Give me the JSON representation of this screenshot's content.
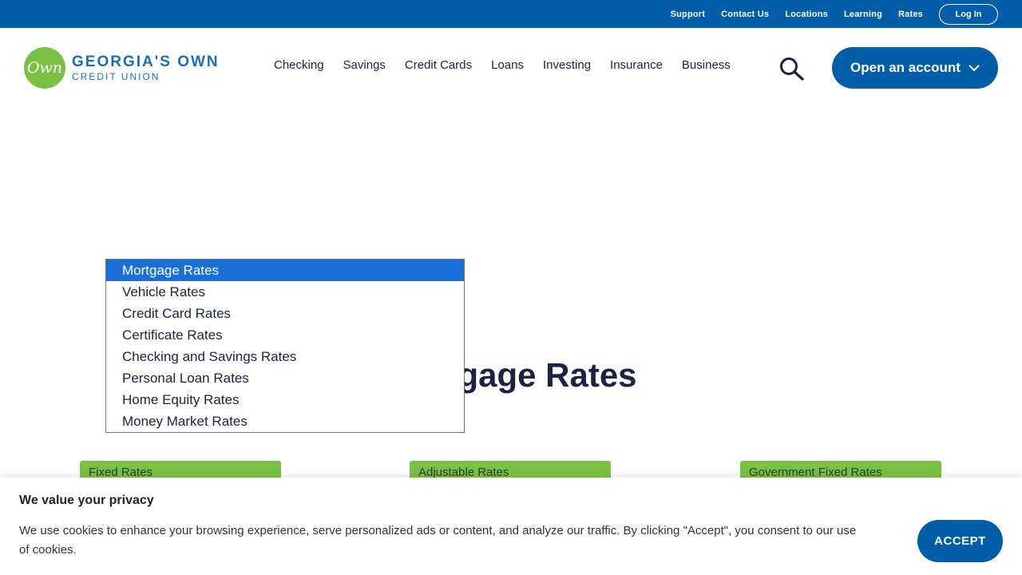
{
  "utility_nav": {
    "links": [
      "Support",
      "Contact Us",
      "Locations",
      "Learning",
      "Rates"
    ],
    "login_label": "Log In"
  },
  "brand": {
    "logo_mark": "Own",
    "name_line1": "GEORGIA'S OWN",
    "name_line2": "CREDIT UNION"
  },
  "main_nav": {
    "items": [
      "Checking",
      "Savings",
      "Credit Cards",
      "Loans",
      "Investing",
      "Insurance",
      "Business"
    ],
    "search_icon": "search-icon",
    "open_account_label": "Open an account"
  },
  "page": {
    "title": "Mortgage Rates"
  },
  "rates_dropdown": {
    "options": [
      "Mortgage Rates",
      "Vehicle Rates",
      "Credit Card Rates",
      "Certificate Rates",
      "Checking and Savings Rates",
      "Personal Loan Rates",
      "Home Equity Rates",
      "Money Market Rates"
    ],
    "selected": "Mortgage Rates"
  },
  "rate_tabs": [
    "Fixed Rates",
    "Adjustable Rates",
    "Government Fixed Rates"
  ],
  "cookie_banner": {
    "title": "We value your privacy",
    "text": "We use cookies to enhance your browsing experience, serve personalized ads or content, and analyze our traffic. By clicking \"Accept\", you consent to our use of cookies.",
    "accept_label": "ACCEPT"
  },
  "colors": {
    "brand_blue": "#005ea8",
    "brand_green": "#7ac143",
    "selected_option": "#1a6fd8",
    "text_dark": "#1b2340"
  }
}
